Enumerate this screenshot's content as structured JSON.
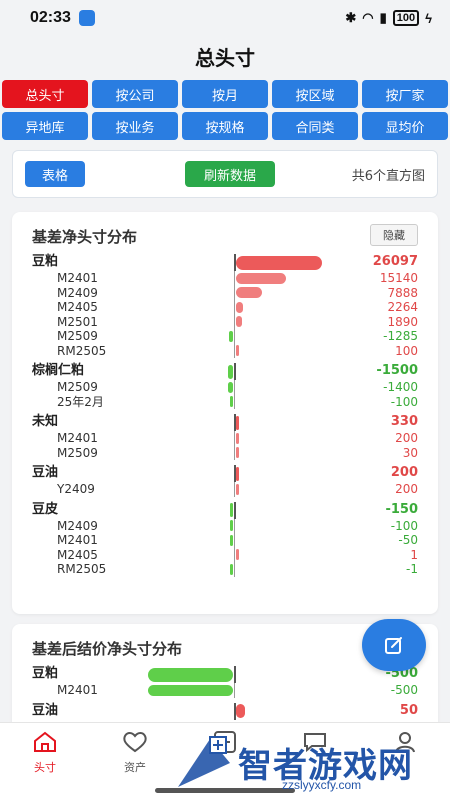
{
  "status_bar": {
    "time": "02:33",
    "battery": "100"
  },
  "page_title": "总头寸",
  "tabs": [
    {
      "label": "总头寸",
      "active": true
    },
    {
      "label": "按公司",
      "active": false
    },
    {
      "label": "按月",
      "active": false
    },
    {
      "label": "按区域",
      "active": false
    },
    {
      "label": "按厂家",
      "active": false
    },
    {
      "label": "异地库",
      "active": false
    },
    {
      "label": "按业务",
      "active": false
    },
    {
      "label": "按规格",
      "active": false
    },
    {
      "label": "合同类",
      "active": false
    },
    {
      "label": "显均价",
      "active": false
    }
  ],
  "toolbar": {
    "table_button": "表格",
    "refresh_button": "刷新数据",
    "count_text": "共6个直方图"
  },
  "card1": {
    "title": "基差净头寸分布",
    "hide_button": "隐藏",
    "rows": [
      {
        "label": "豆粕",
        "value": "26097",
        "num": 26097,
        "group": true
      },
      {
        "label": "M2401",
        "value": "15140",
        "num": 15140,
        "group": false
      },
      {
        "label": "M2409",
        "value": "7888",
        "num": 7888,
        "group": false
      },
      {
        "label": "M2405",
        "value": "2264",
        "num": 2264,
        "group": false
      },
      {
        "label": "M2501",
        "value": "1890",
        "num": 1890,
        "group": false
      },
      {
        "label": "M2509",
        "value": "-1285",
        "num": -1285,
        "group": false
      },
      {
        "label": "RM2505",
        "value": "100",
        "num": 100,
        "group": false
      },
      {
        "label": "棕榈仁粕",
        "value": "-1500",
        "num": -1500,
        "group": true
      },
      {
        "label": "M2509",
        "value": "-1400",
        "num": -1400,
        "group": false
      },
      {
        "label": "25年2月",
        "value": "-100",
        "num": -100,
        "group": false
      },
      {
        "label": "未知",
        "value": "330",
        "num": 330,
        "group": true
      },
      {
        "label": "M2401",
        "value": "200",
        "num": 200,
        "group": false
      },
      {
        "label": "M2509",
        "value": "30",
        "num": 30,
        "group": false
      },
      {
        "label": "豆油",
        "value": "200",
        "num": 200,
        "group": true
      },
      {
        "label": "Y2409",
        "value": "200",
        "num": 200,
        "group": false
      },
      {
        "label": "豆皮",
        "value": "-150",
        "num": -150,
        "group": true
      },
      {
        "label": "M2409",
        "value": "-100",
        "num": -100,
        "group": false
      },
      {
        "label": "M2401",
        "value": "-50",
        "num": -50,
        "group": false
      },
      {
        "label": "M2405",
        "value": "1",
        "num": 1,
        "group": false
      },
      {
        "label": "RM2505",
        "value": "-1",
        "num": -1,
        "group": false
      }
    ]
  },
  "card2": {
    "title": "基差后结价净头寸分布",
    "rows": [
      {
        "label": "豆粕",
        "value": "-500",
        "num": -500,
        "group": true
      },
      {
        "label": "M2401",
        "value": "-500",
        "num": -500,
        "group": false
      },
      {
        "label": "豆油",
        "value": "50",
        "num": 50,
        "group": true
      }
    ]
  },
  "bottom_nav": [
    {
      "label": "头寸",
      "icon": "home-icon",
      "active": true
    },
    {
      "label": "资产",
      "icon": "heart-icon",
      "active": false
    },
    {
      "label": "",
      "icon": "plus-icon",
      "active": false
    },
    {
      "label": "",
      "icon": "chat-icon",
      "active": false
    },
    {
      "label": "",
      "icon": "user-icon",
      "active": false
    }
  ],
  "watermark": {
    "text": "智者游戏网",
    "url": "zzslyyxcfy.com"
  },
  "colors": {
    "accent": "#2a7de1",
    "active_tab": "#e4141e",
    "positive": "#e04848",
    "negative": "#3aab3a"
  }
}
